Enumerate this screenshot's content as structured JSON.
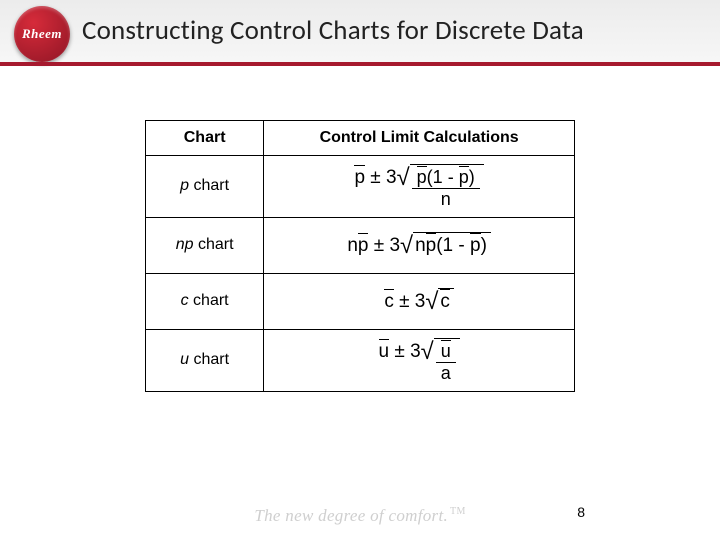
{
  "brand": {
    "logo_text": "Rheem"
  },
  "title": "Constructing Control Charts for Discrete Data",
  "table": {
    "headers": {
      "chart": "Chart",
      "calc": "Control Limit Calculations"
    },
    "rows": [
      {
        "name_prefix": "p",
        "name_suffix": " chart"
      },
      {
        "name_prefix": "np",
        "name_suffix": "  chart"
      },
      {
        "name_prefix": "c",
        "name_suffix": " chart"
      },
      {
        "name_prefix": "u",
        "name_suffix": " chart"
      }
    ]
  },
  "formulas": {
    "pm": " ± 3",
    "p": {
      "pbar": "p",
      "one_minus": "(1 - ",
      "close": ")",
      "n": "n"
    },
    "np": {
      "np_bar_n": "n",
      "np_bar_p": "p",
      "rad_n": "n",
      "rad_p": "p",
      "one_minus": "(1 - ",
      "close": ")"
    },
    "c": {
      "cbar": "c"
    },
    "u": {
      "ubar": "u",
      "a": "a"
    }
  },
  "footer": {
    "tagline": "The new degree of comfort.",
    "tm": "TM",
    "page": "8"
  }
}
